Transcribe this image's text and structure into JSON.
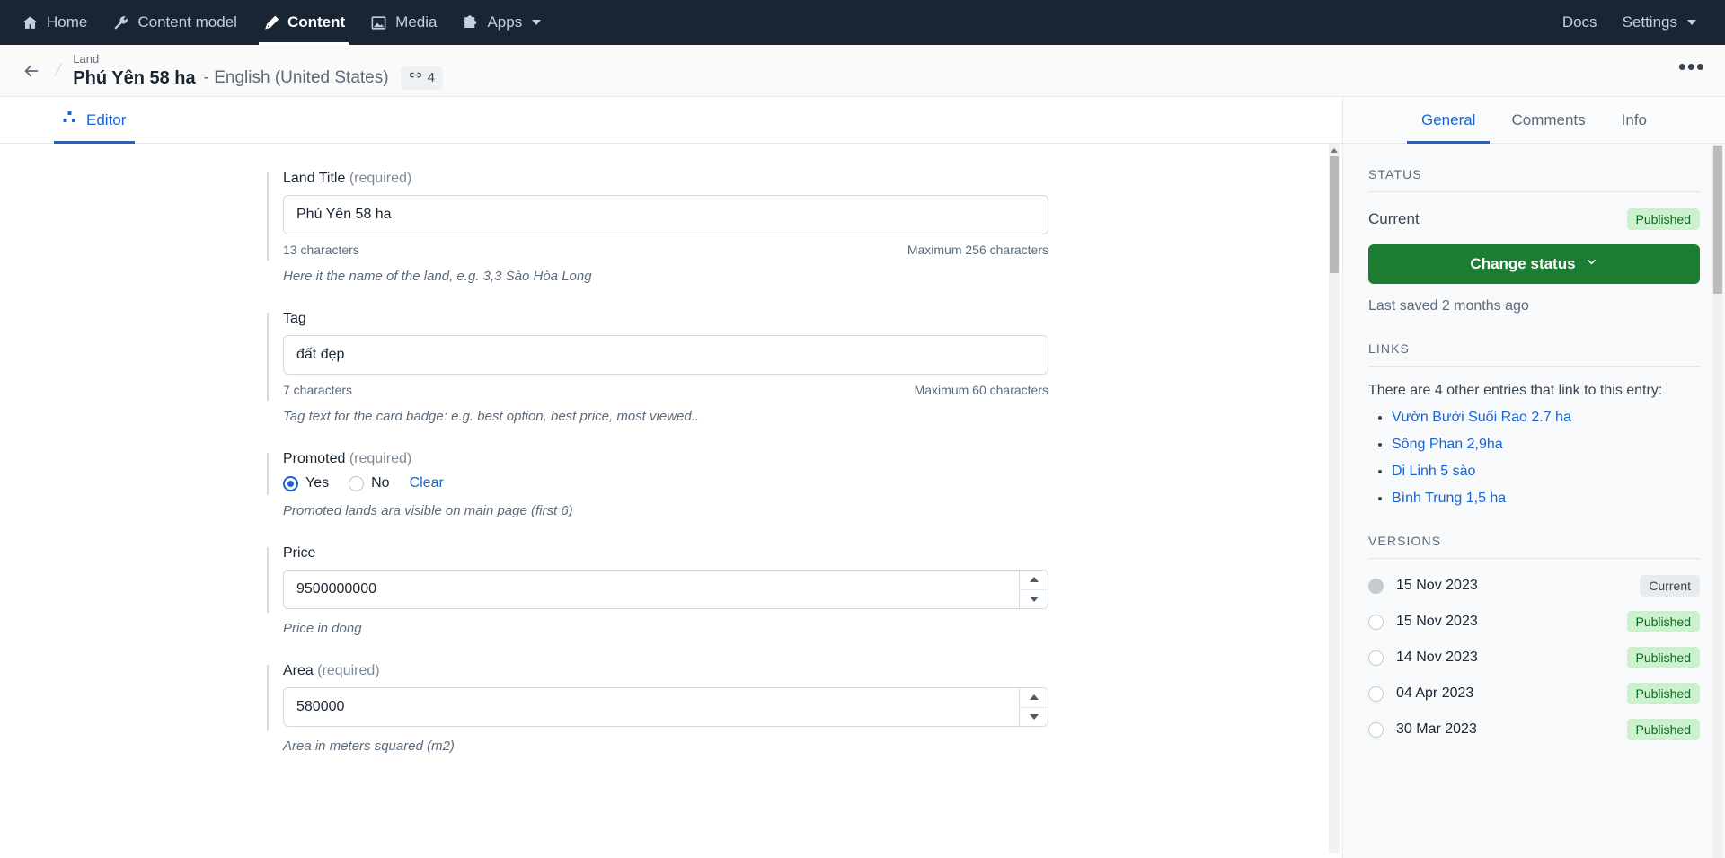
{
  "topnav": {
    "left_items": [
      {
        "label": "Home",
        "icon": "home-icon",
        "active": false
      },
      {
        "label": "Content model",
        "icon": "wrench-icon",
        "active": false
      },
      {
        "label": "Content",
        "icon": "pen-nib-icon",
        "active": true
      },
      {
        "label": "Media",
        "icon": "image-icon",
        "active": false
      },
      {
        "label": "Apps",
        "icon": "puzzle-icon",
        "active": false,
        "caret": true
      }
    ],
    "right_items": [
      {
        "label": "Docs",
        "caret": false
      },
      {
        "label": "Settings",
        "caret": true
      }
    ]
  },
  "entry_header": {
    "content_type": "Land",
    "title": "Phú Yên 58 ha",
    "locale": "- English (United States)",
    "link_count": "4",
    "more_label": "•••"
  },
  "editor": {
    "tabs": [
      {
        "label": "Editor",
        "icon": "editor-dots-icon",
        "active": true
      }
    ],
    "fields": [
      {
        "name": "land-title",
        "label": "Land Title",
        "required": "(required)",
        "type": "text",
        "value": "Phú Yên 58 ha",
        "char_count": "13 characters",
        "max_text": "Maximum 256 characters",
        "help": "Here it the name of the land, e.g. 3,3 Sào Hòa Long"
      },
      {
        "name": "tag",
        "label": "Tag",
        "required": "",
        "type": "text",
        "value": "đất đẹp",
        "char_count": "7 characters",
        "max_text": "Maximum 60 characters",
        "help": "Tag text for the card badge: e.g. best option, best price, most viewed.."
      },
      {
        "name": "promoted",
        "label": "Promoted",
        "required": "(required)",
        "type": "radio",
        "options": [
          {
            "label": "Yes",
            "checked": true
          },
          {
            "label": "No",
            "checked": false
          }
        ],
        "clear_label": "Clear",
        "help": "Promoted lands ara visible on main page (first 6)"
      },
      {
        "name": "price",
        "label": "Price",
        "required": "",
        "type": "number",
        "value": "9500000000",
        "help": "Price in dong"
      },
      {
        "name": "area",
        "label": "Area",
        "required": "(required)",
        "type": "number",
        "value": "580000",
        "help": "Area in meters squared (m2)"
      }
    ]
  },
  "sidebar": {
    "tabs": [
      {
        "label": "General",
        "active": true
      },
      {
        "label": "Comments",
        "active": false
      },
      {
        "label": "Info",
        "active": false
      }
    ],
    "status": {
      "heading": "STATUS",
      "current_label": "Current",
      "current_badge": "Published",
      "change_status_label": "Change status",
      "last_saved": "Last saved 2 months ago"
    },
    "links": {
      "heading": "LINKS",
      "intro": "There are 4 other entries that link to this entry:",
      "items": [
        "Vườn Bưởi Suối Rao 2.7 ha",
        "Sông Phan 2,9ha",
        "Di Linh 5 sào",
        "Bình Trung 1,5 ha"
      ]
    },
    "versions": {
      "heading": "VERSIONS",
      "items": [
        {
          "date": "15 Nov 2023",
          "badge": "Current",
          "badge_kind": "current",
          "selected": true
        },
        {
          "date": "15 Nov 2023",
          "badge": "Published",
          "badge_kind": "published",
          "selected": false
        },
        {
          "date": "14 Nov 2023",
          "badge": "Published",
          "badge_kind": "published",
          "selected": false
        },
        {
          "date": "04 Apr 2023",
          "badge": "Published",
          "badge_kind": "published",
          "selected": false
        },
        {
          "date": "30 Mar 2023",
          "badge": "Published",
          "badge_kind": "published",
          "selected": false
        }
      ]
    }
  },
  "colors": {
    "nav_bg": "#192532",
    "accent_blue": "#1a64d1",
    "publish_green": "#1c7c31",
    "badge_green_bg": "#cdf1ce",
    "badge_green_text": "#0d6a21"
  }
}
